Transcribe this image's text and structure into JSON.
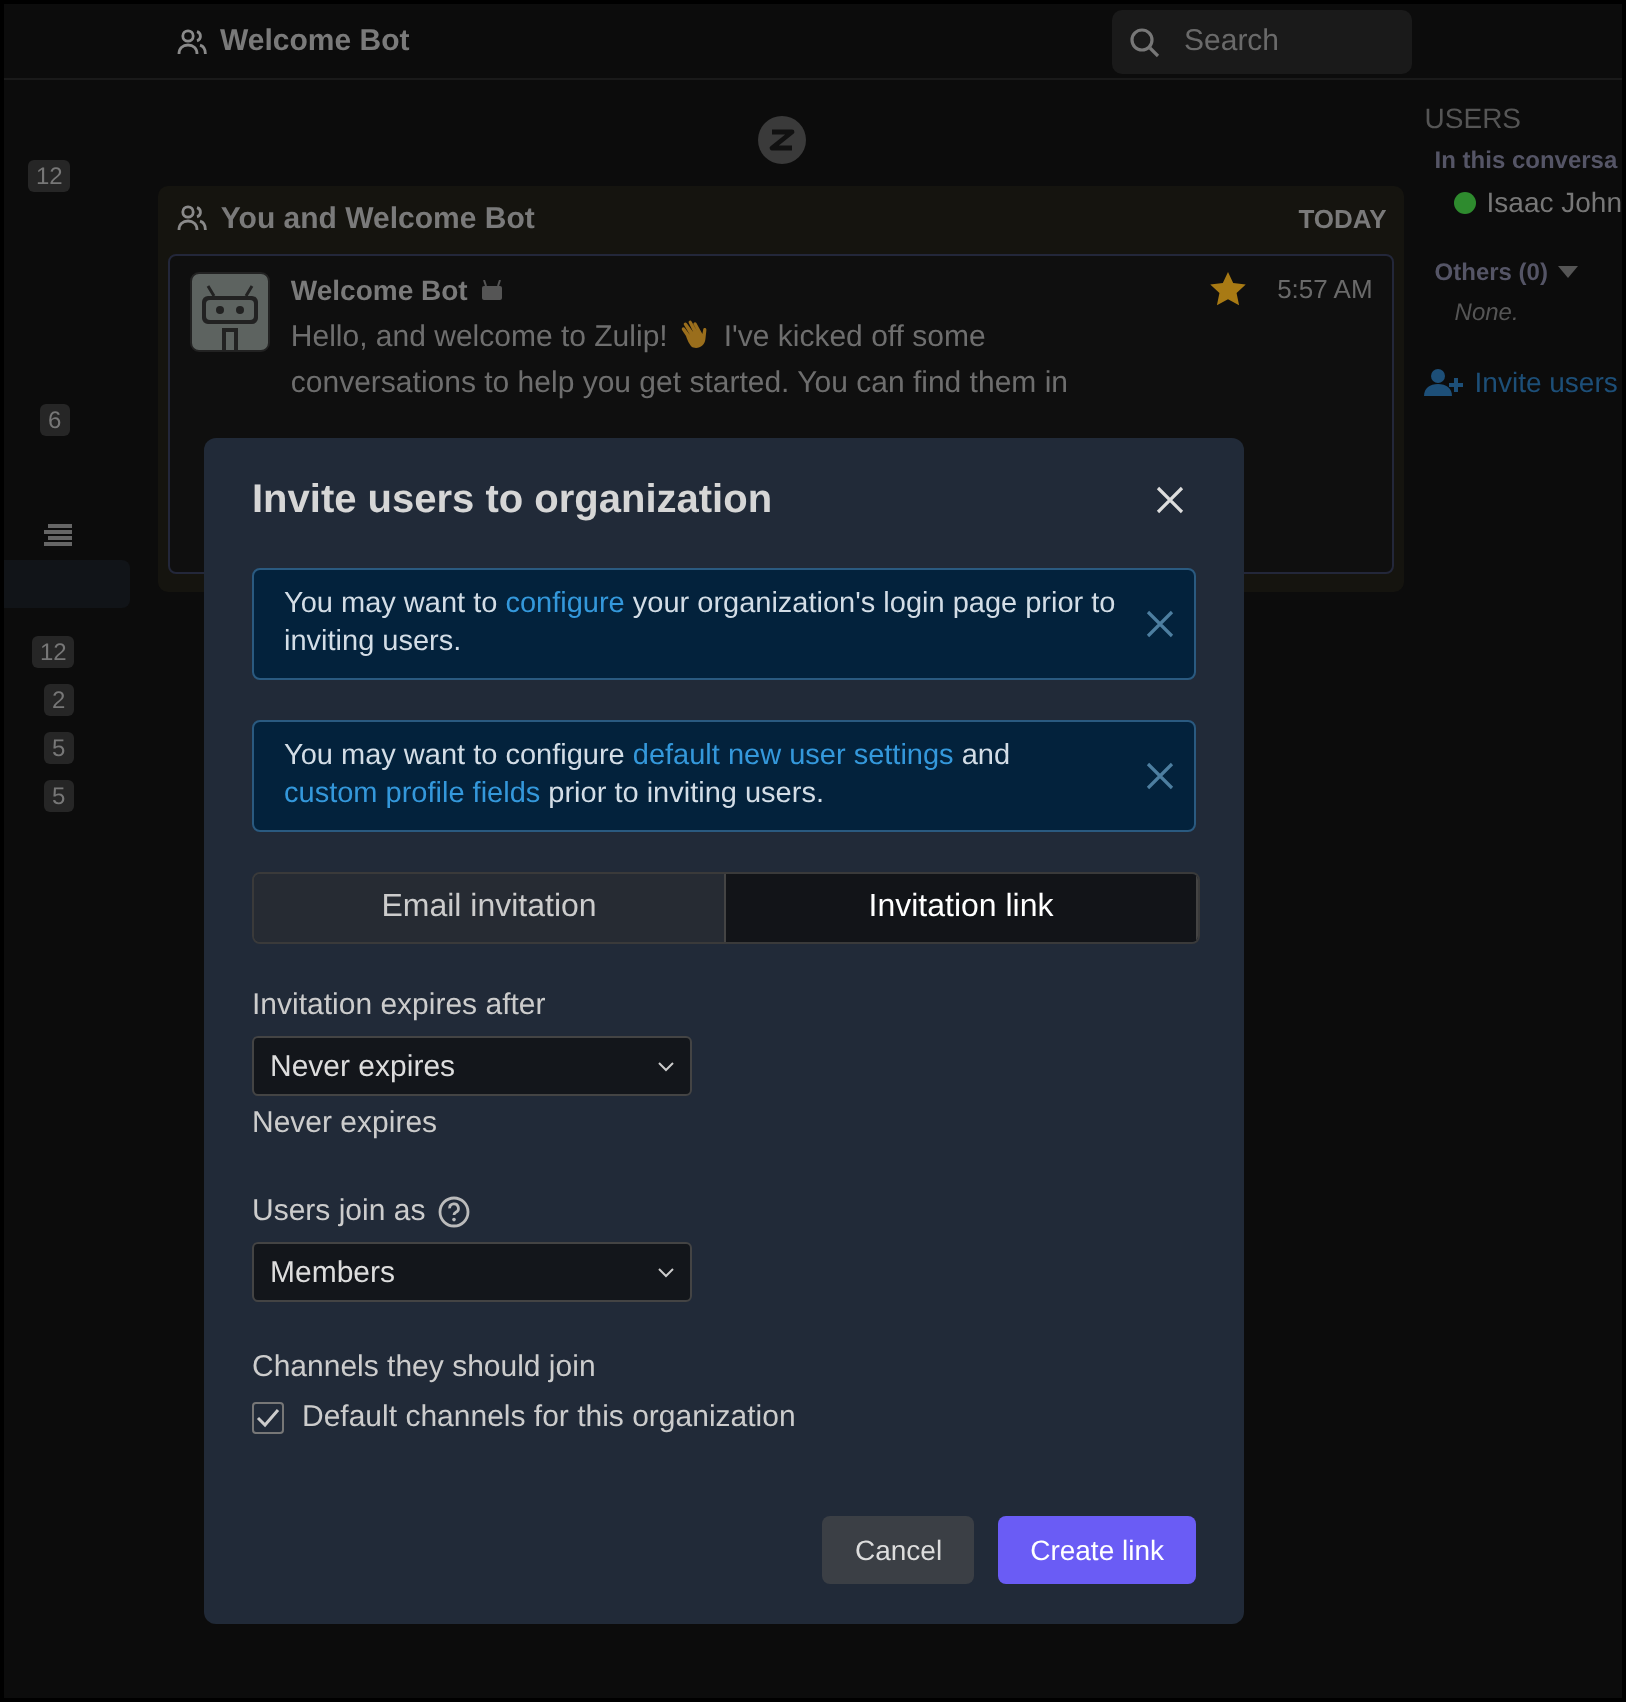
{
  "header": {
    "title": "Welcome Bot",
    "search": {
      "placeholder": "Search"
    }
  },
  "left_sidebar": {
    "counts": [
      {
        "count": "12",
        "selected": false
      },
      {
        "count": "6",
        "selected": false
      }
    ],
    "channel_counts": [
      "12",
      "2",
      "5",
      "5"
    ]
  },
  "conversation": {
    "title": "You and Welcome Bot",
    "date": "TODAY",
    "message": {
      "sender": "Welcome Bot",
      "starred": true,
      "time": "5:57 AM",
      "text_start": "Hello, and welcome to Zulip!",
      "text_line1_end": "I've kicked off some",
      "text_line2": "conversations to help you get started. You can find them in"
    }
  },
  "right_sidebar": {
    "heading": "USERS",
    "section": "In this conversa",
    "users": [
      {
        "name": "Isaac John",
        "color": "#2e8b2e"
      }
    ],
    "others": "Others (0)",
    "none": "None.",
    "invite": "Invite users"
  },
  "modal": {
    "title": "Invite users to organization",
    "alerts": [
      {
        "parts": [
          {
            "text": "You may want to "
          },
          {
            "text": "configure",
            "link": true
          },
          {
            "text": " your organization's login page prior to inviting users."
          }
        ]
      },
      {
        "parts": [
          {
            "text": "You may want to configure "
          },
          {
            "text": "default new user settings",
            "link": true
          },
          {
            "text": " and "
          },
          {
            "text": "custom profile fields",
            "link": true
          },
          {
            "text": " prior to inviting users."
          }
        ]
      }
    ],
    "tabs": [
      {
        "label": "Email invitation",
        "selected": false
      },
      {
        "label": "Invitation link",
        "selected": true
      }
    ],
    "expires_label": "Invitation expires after",
    "expires_value": "Never expires",
    "expires_note": "Never expires",
    "join_label": "Users join as",
    "join_value": "Members",
    "channels_label": "Channels they should join",
    "default_channels": {
      "label": "Default channels for this organization",
      "checked": true
    },
    "buttons": [
      {
        "label": "Cancel",
        "kind": "secondary"
      },
      {
        "label": "Create link",
        "kind": "primary"
      }
    ]
  }
}
